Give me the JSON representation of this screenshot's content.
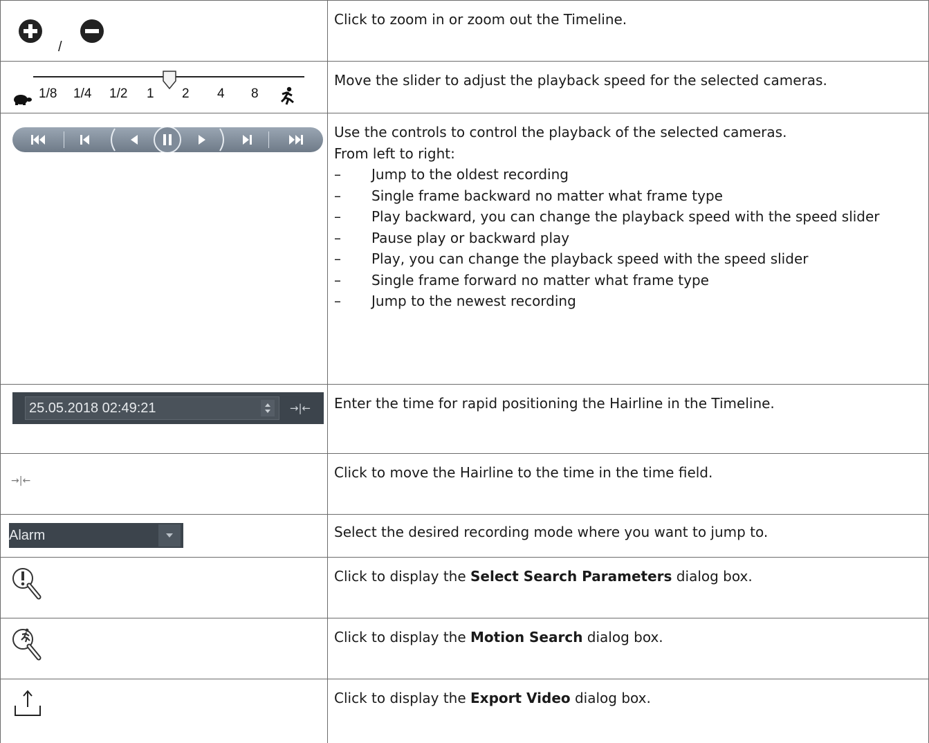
{
  "rows": [
    {
      "id": "zoom",
      "separator": "/",
      "description": "Click to zoom in or zoom out the Timeline."
    },
    {
      "id": "speed",
      "speed_ticks": [
        "1/8",
        "1/4",
        "1/2",
        "1",
        "2",
        "4",
        "8"
      ],
      "speed_value": "1",
      "description": "Move the slider to adjust the playback speed for the selected cameras."
    },
    {
      "id": "playback",
      "description": "Use the controls to control the playback of the selected cameras.",
      "intro": "From left to right:",
      "bullet": "–",
      "items": [
        "Jump to the oldest recording",
        "Single frame backward no matter what frame type",
        "Play backward, you can change the playback speed with the speed slider",
        "Pause play or backward play",
        "Play, you can change the playback speed with the speed slider",
        "Single frame forward no matter what frame type",
        "Jump to the newest recording"
      ],
      "buttons": [
        "jump-oldest-icon",
        "frame-back-icon",
        "play-backward-icon",
        "pause-icon",
        "play-icon",
        "frame-forward-icon",
        "jump-newest-icon"
      ]
    },
    {
      "id": "time",
      "time_value": "25.05.2018 02:49:21",
      "description": "Enter the time for rapid positioning the Hairline in the Timeline."
    },
    {
      "id": "hairline",
      "description": "Click to move the Hairline to the time in the time field."
    },
    {
      "id": "mode",
      "mode_value": "Alarm",
      "description": "Select the desired recording mode where you want to jump to."
    },
    {
      "id": "search",
      "pre": "Click to display the ",
      "bold": "Select Search Parameters",
      "post": " dialog box."
    },
    {
      "id": "motion",
      "pre": "Click to display the ",
      "bold": "Motion Search",
      "post": " dialog box."
    },
    {
      "id": "export",
      "pre": "Click to display the ",
      "bold": "Export Video",
      "post": " dialog box."
    }
  ],
  "colors": {
    "border": "#6b6b6b",
    "control_dark": "#3c444c",
    "pill": "#8591a0",
    "icon_dark": "#222222"
  }
}
